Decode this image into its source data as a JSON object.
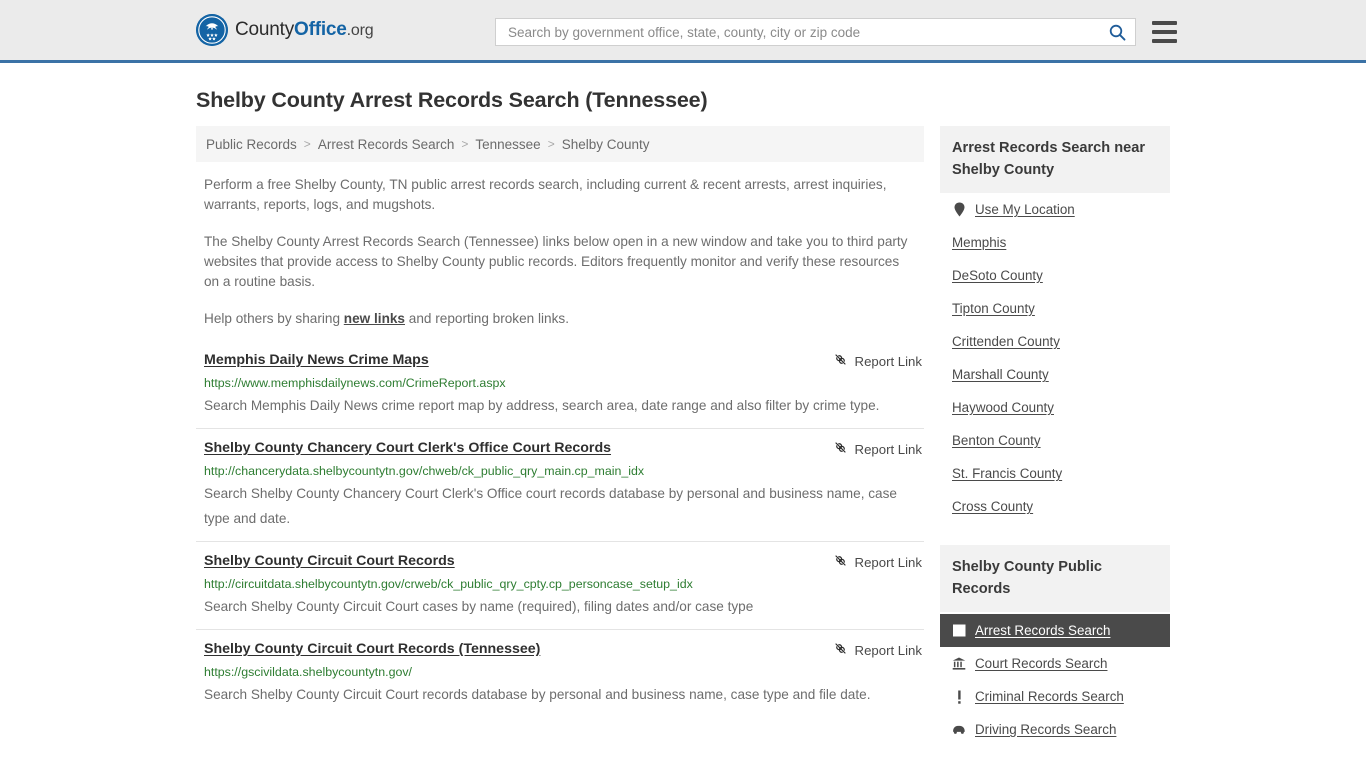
{
  "header": {
    "logo_text_county": "County",
    "logo_text_office": "Office",
    "logo_text_tld": ".org",
    "logo_icon": "eagle-seal-icon",
    "search_placeholder": "Search by government office, state, county, city or zip code",
    "search_value": "",
    "search_icon": "search-icon",
    "menu_icon": "hamburger-menu-icon"
  },
  "page": {
    "title": "Shelby County Arrest Records Search (Tennessee)"
  },
  "breadcrumb": {
    "separator": ">",
    "items": [
      {
        "label": "Public Records"
      },
      {
        "label": "Arrest Records Search"
      },
      {
        "label": "Tennessee"
      },
      {
        "label": "Shelby County"
      }
    ]
  },
  "intro": {
    "p1": "Perform a free Shelby County, TN public arrest records search, including current & recent arrests, arrest inquiries, warrants, reports, logs, and mugshots.",
    "p2": "The Shelby County Arrest Records Search (Tennessee) links below open in a new window and take you to third party websites that provide access to Shelby County public records. Editors frequently monitor and verify these resources on a routine basis.",
    "p3_pre": "Help others by sharing ",
    "p3_link": "new links",
    "p3_post": " and reporting broken links."
  },
  "report_link_label": "Report Link",
  "report_link_icon": "broken-link-icon",
  "results": [
    {
      "title": "Memphis Daily News Crime Maps",
      "url": "https://www.memphisdailynews.com/CrimeReport.aspx",
      "description": "Search Memphis Daily News crime report map by address, search area, date range and also filter by crime type."
    },
    {
      "title": "Shelby County Chancery Court Clerk's Office Court Records",
      "url": "http://chancerydata.shelbycountytn.gov/chweb/ck_public_qry_main.cp_main_idx",
      "description": "Search Shelby County Chancery Court Clerk's Office court records database by personal and business name, case type and date."
    },
    {
      "title": "Shelby County Circuit Court Records",
      "url": "http://circuitdata.shelbycountytn.gov/crweb/ck_public_qry_cpty.cp_personcase_setup_idx",
      "description": "Search Shelby County Circuit Court cases by name (required), filing dates and/or case type"
    },
    {
      "title": "Shelby County Circuit Court Records (Tennessee)",
      "url": "https://gscivildata.shelbycountytn.gov/",
      "description": "Search Shelby County Circuit Court records database by personal and business name, case type and file date."
    }
  ],
  "sidebar": {
    "nearby": {
      "heading": "Arrest Records Search near Shelby County",
      "items": [
        {
          "label": "Use My Location",
          "icon": "map-pin-icon"
        },
        {
          "label": "Memphis",
          "icon": ""
        },
        {
          "label": "DeSoto County",
          "icon": ""
        },
        {
          "label": "Tipton County",
          "icon": ""
        },
        {
          "label": "Crittenden County",
          "icon": ""
        },
        {
          "label": "Marshall County",
          "icon": ""
        },
        {
          "label": "Haywood County",
          "icon": ""
        },
        {
          "label": "Benton County",
          "icon": ""
        },
        {
          "label": "St. Francis County",
          "icon": ""
        },
        {
          "label": "Cross County",
          "icon": ""
        }
      ]
    },
    "public_records": {
      "heading": "Shelby County Public Records",
      "items": [
        {
          "label": "Arrest Records Search",
          "icon": "white-square-icon",
          "active": true
        },
        {
          "label": "Court Records Search",
          "icon": "courthouse-icon",
          "active": false
        },
        {
          "label": "Criminal Records Search",
          "icon": "exclamation-icon",
          "active": false
        },
        {
          "label": "Driving Records Search",
          "icon": "car-icon",
          "active": false
        }
      ]
    }
  },
  "colors": {
    "header_bg": "#ebebeb",
    "header_border": "#3b72a6",
    "brand_blue": "#1464a5",
    "url_green": "#2e7d32",
    "active_bg": "#4a4a4a",
    "panel_gray": "#f2f2f2"
  }
}
